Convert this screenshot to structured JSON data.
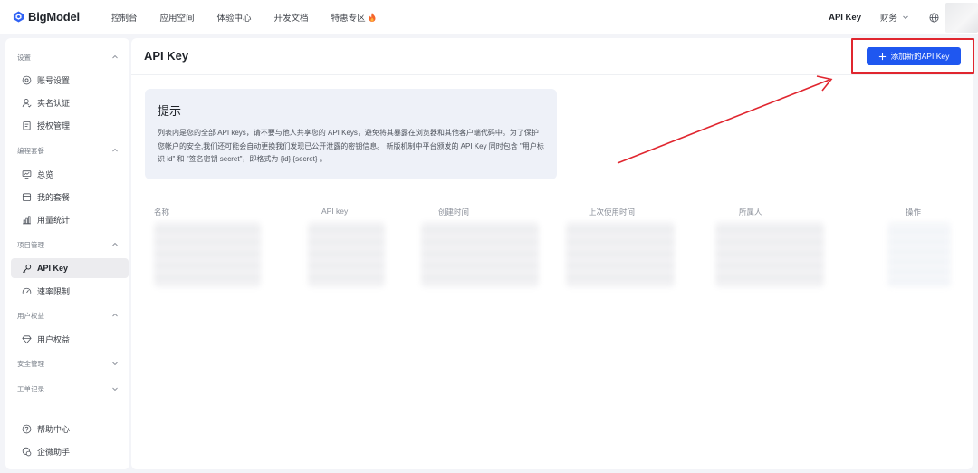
{
  "header": {
    "logo_text": "BigModel",
    "nav": [
      {
        "label": "控制台"
      },
      {
        "label": "应用空间"
      },
      {
        "label": "体验中心"
      },
      {
        "label": "开发文档"
      },
      {
        "label": "特惠专区",
        "icon": "fire-icon"
      }
    ],
    "api_key_label": "API Key",
    "finance_label": "财务",
    "language_icon": "globe-icon"
  },
  "sidebar": {
    "groups": [
      {
        "label": "设置",
        "items": [
          {
            "label": "账号设置",
            "icon": "gear-icon"
          },
          {
            "label": "实名认证",
            "icon": "user-icon"
          },
          {
            "label": "授权管理",
            "icon": "clipboard-icon"
          }
        ]
      },
      {
        "label": "编程套餐",
        "items": [
          {
            "label": "总览",
            "icon": "monitor-icon"
          },
          {
            "label": "我的套餐",
            "icon": "box-icon"
          },
          {
            "label": "用量统计",
            "icon": "chart-icon"
          }
        ]
      },
      {
        "label": "项目管理",
        "items": [
          {
            "label": "API Key",
            "icon": "key-icon",
            "active": true
          },
          {
            "label": "速率限制",
            "icon": "speed-icon"
          }
        ]
      },
      {
        "label": "用户权益",
        "items": [
          {
            "label": "用户权益",
            "icon": "diamond-icon"
          }
        ]
      },
      {
        "label": "安全管理",
        "items": []
      },
      {
        "label": "工单记录",
        "items": []
      }
    ],
    "footer": [
      {
        "label": "帮助中心",
        "icon": "help-icon"
      },
      {
        "label": "企微助手",
        "icon": "chat-icon"
      }
    ]
  },
  "main": {
    "title": "API Key",
    "add_button_label": "添加新的API Key",
    "tip": {
      "title": "提示",
      "body": "列表内是您的全部 API keys，请不要与他人共享您的 API Keys，避免将其暴露在浏览器和其他客户端代码中。为了保护您帐户的安全,我们还可能会自动更换我们发现已公开泄露的密钥信息。 新版机制中平台颁发的 API Key 同时包含 \"用户标识 id\" 和 \"签名密钥 secret\"，即格式为 {id}.{secret} 。"
    },
    "table": {
      "columns": [
        "名称",
        "API key",
        "创建时间",
        "上次使用时间",
        "所属人",
        "操作"
      ]
    }
  },
  "colors": {
    "accent": "#1f57f0",
    "highlight_annotation": "#e0262f",
    "tip_background": "#eef1f8"
  }
}
